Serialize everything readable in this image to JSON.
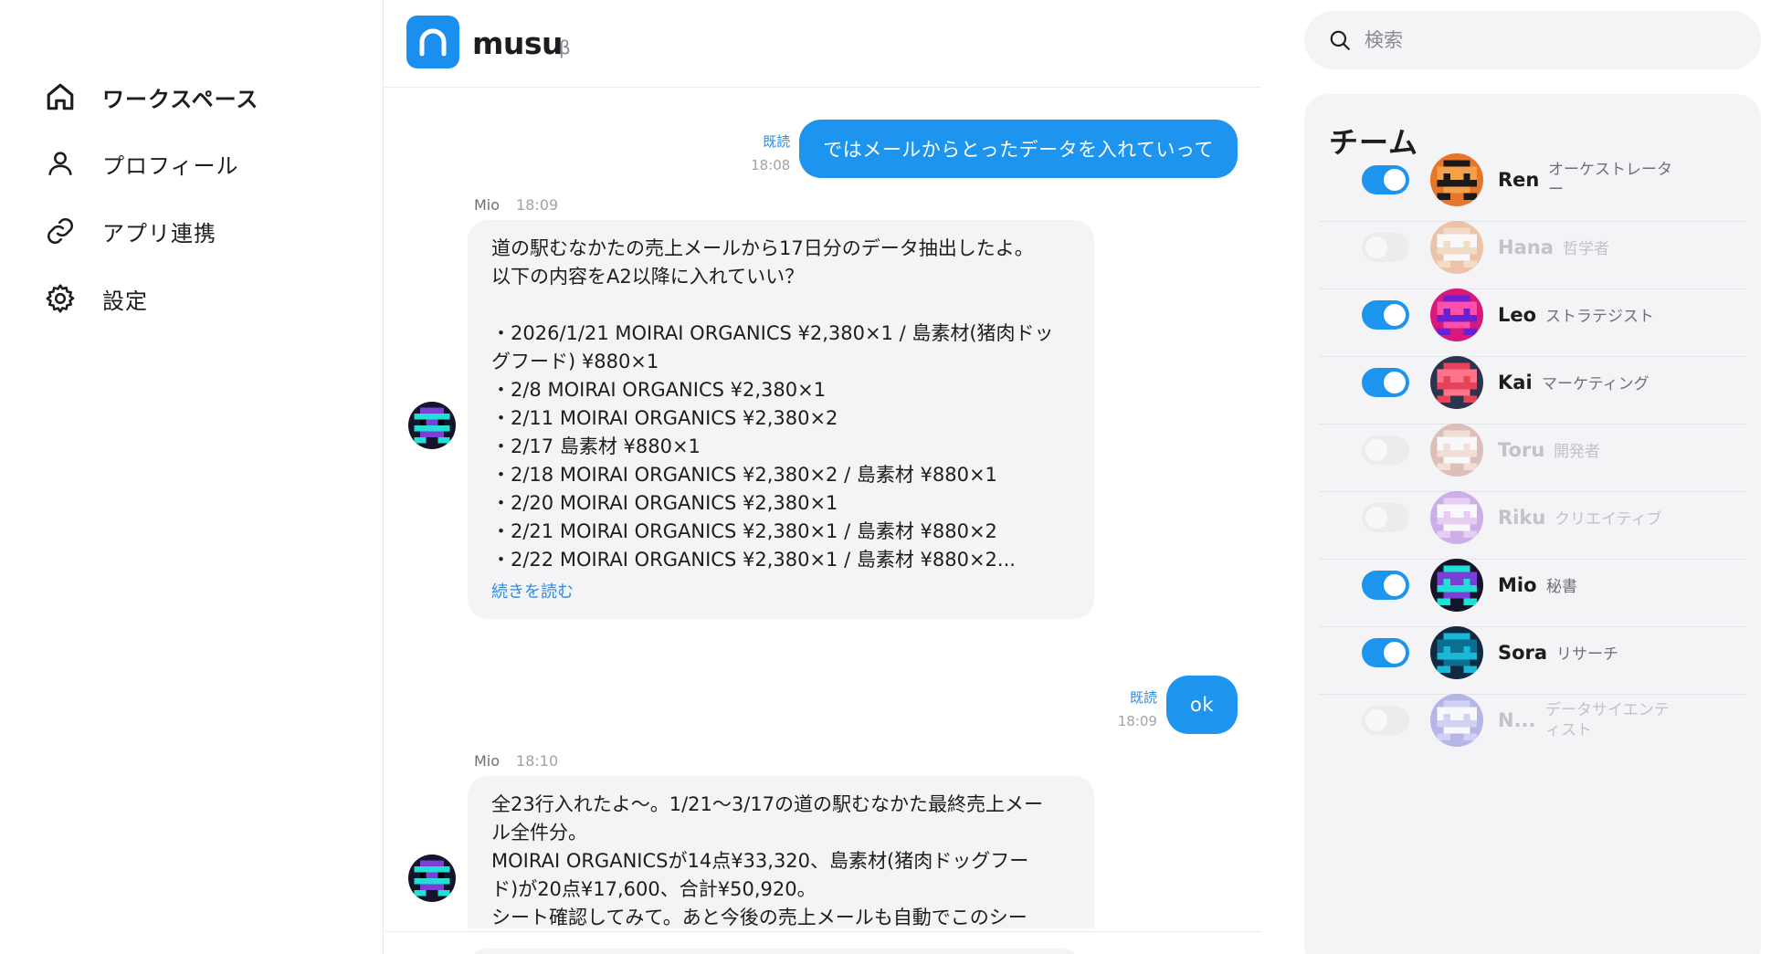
{
  "nav": {
    "items": [
      {
        "label": "ワークスペース",
        "icon": "home-icon",
        "active": true
      },
      {
        "label": "プロフィール",
        "icon": "person-icon",
        "active": false
      },
      {
        "label": "アプリ連携",
        "icon": "link-icon",
        "active": false
      },
      {
        "label": "設定",
        "icon": "gear-icon",
        "active": false
      }
    ]
  },
  "header": {
    "brand": "musu",
    "beta": "β",
    "logo_color": "#1b8ff0"
  },
  "messages": [
    {
      "type": "out",
      "read": "既読",
      "time": "18:08",
      "text": "ではメールからとったデータを入れていって"
    },
    {
      "type": "in",
      "sender": "Mio",
      "time": "18:09",
      "lines": [
        "道の駅むなかたの売上メールから17日分のデータ抽出したよ。",
        "以下の内容をA2以降に入れていい？",
        "",
        "・2026/1/21 MOIRAI ORGANICS ¥2,380×1 / 島素材(猪肉ドッ",
        "グフード) ¥880×1",
        "・2/8 MOIRAI ORGANICS ¥2,380×1",
        "・2/11 MOIRAI ORGANICS ¥2,380×2",
        "・2/17 島素材 ¥880×1",
        "・2/18 MOIRAI ORGANICS ¥2,380×2 / 島素材 ¥880×1",
        "・2/20 MOIRAI ORGANICS ¥2,380×1",
        "・2/21 MOIRAI ORGANICS ¥2,380×1 / 島素材 ¥880×2",
        "・2/22 MOIRAI ORGANICS ¥2,380×1 / 島素材 ¥880×2..."
      ],
      "more": "続きを読む"
    },
    {
      "type": "out",
      "read": "既読",
      "time": "18:09",
      "text": "ok"
    },
    {
      "type": "in",
      "sender": "Mio",
      "time": "18:10",
      "lines": [
        "全23行入れたよ〜。1/21〜3/17の道の駅むなかた最終売上メー",
        "ル全件分。",
        "MOIRAI ORGANICSが14点¥33,320、島素材(猪肉ドッグフー",
        "ド)が20点¥17,600、合計¥50,920。",
        "シート確認してみて。あと今後の売上メールも自動でこのシー"
      ]
    }
  ],
  "search": {
    "placeholder": "検索"
  },
  "team": {
    "title": "チーム",
    "members": [
      {
        "name": "Ren",
        "role": "オーケストレーター",
        "enabled": true
      },
      {
        "name": "Hana",
        "role": "哲学者",
        "enabled": false
      },
      {
        "name": "Leo",
        "role": "ストラテジスト",
        "enabled": true
      },
      {
        "name": "Kai",
        "role": "マーケティング",
        "enabled": true
      },
      {
        "name": "Toru",
        "role": "開発者",
        "enabled": false
      },
      {
        "name": "Riku",
        "role": "クリエイティブ",
        "enabled": false
      },
      {
        "name": "Mio",
        "role": "秘書",
        "enabled": true
      },
      {
        "name": "Sora",
        "role": "リサーチ",
        "enabled": true
      },
      {
        "name": "N...",
        "role": "データサイエンティスト",
        "enabled": false
      }
    ]
  },
  "colors": {
    "accent": "#1d95ef",
    "read": "#2a8ce8"
  }
}
